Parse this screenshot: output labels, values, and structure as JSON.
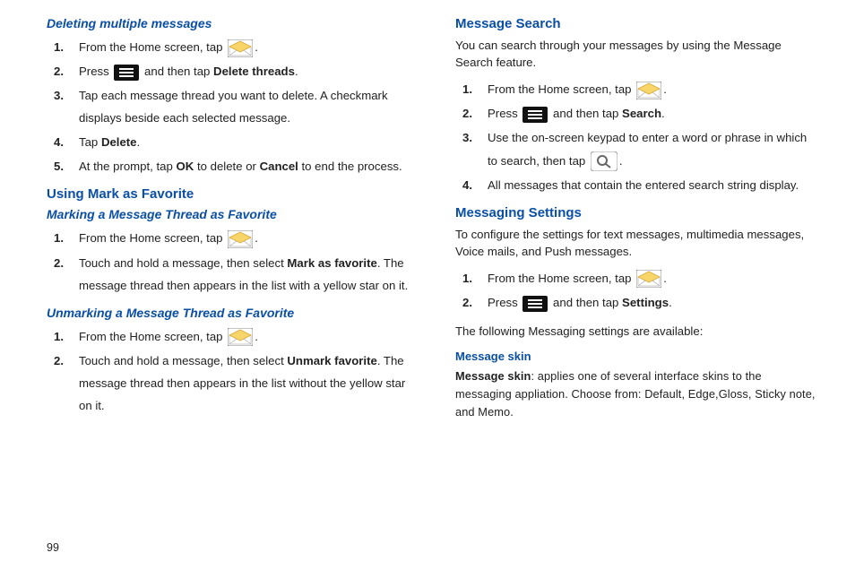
{
  "pageNumber": "99",
  "left": {
    "sec1": {
      "heading": "Deleting multiple messages",
      "steps": [
        {
          "num": "1.",
          "pre": "From the Home screen, tap ",
          "icon": "envelope",
          "post": "."
        },
        {
          "num": "2.",
          "pre": "Press ",
          "icon": "menu",
          "mid": " and then tap ",
          "bold": "Delete threads",
          "post": "."
        },
        {
          "num": "3.",
          "text": "Tap each message thread you want to delete. A checkmark displays beside each selected message."
        },
        {
          "num": "4.",
          "pre": "Tap ",
          "bold": "Delete",
          "post": "."
        },
        {
          "num": "5.",
          "pre": "At the prompt, tap ",
          "bold": "OK",
          "mid": " to delete or ",
          "bold2": "Cancel",
          "post": " to end the process."
        }
      ]
    },
    "sec2": {
      "heading": "Using Mark as Favorite",
      "sub1": {
        "heading": "Marking a Message Thread as Favorite",
        "steps": [
          {
            "num": "1.",
            "pre": "From the Home screen, tap ",
            "icon": "envelope",
            "post": "."
          },
          {
            "num": "2.",
            "pre": "Touch and hold a message, then select ",
            "bold": "Mark as favorite",
            "post": ". The message thread then appears in the list with a yellow star on it."
          }
        ]
      },
      "sub2": {
        "heading": "Unmarking a Message Thread as Favorite",
        "steps": [
          {
            "num": "1.",
            "pre": "From the Home screen, tap ",
            "icon": "envelope",
            "post": "."
          },
          {
            "num": "2.",
            "pre": "Touch and hold a message, then select ",
            "bold": "Unmark favorite",
            "post": ". The message thread then appears in the list without the yellow star on it."
          }
        ]
      }
    }
  },
  "right": {
    "sec1": {
      "heading": "Message Search",
      "intro": "You can search through your messages by using the Message Search feature.",
      "steps": [
        {
          "num": "1.",
          "pre": "From the Home screen, tap ",
          "icon": "envelope",
          "post": "."
        },
        {
          "num": "2.",
          "pre": "Press ",
          "icon": "menu",
          "mid": " and then tap ",
          "bold": "Search",
          "post": "."
        },
        {
          "num": "3.",
          "pre": "Use the on-screen keypad to enter a word or phrase in which to search, then tap ",
          "icon": "search",
          "post": "."
        },
        {
          "num": "4.",
          "text": "All messages that contain the entered search string display."
        }
      ]
    },
    "sec2": {
      "heading": "Messaging Settings",
      "intro": "To configure the settings for text messages, multimedia messages, Voice mails, and Push messages.",
      "steps": [
        {
          "num": "1.",
          "pre": "From the Home screen, tap ",
          "icon": "envelope",
          "post": "."
        },
        {
          "num": "2.",
          "pre": "Press ",
          "icon": "menu",
          "mid": " and then tap ",
          "bold": "Settings",
          "post": "."
        }
      ],
      "follow": "The following Messaging settings are available:",
      "sub": {
        "heading": "Message skin",
        "boldLead": "Message skin",
        "text": ": applies one of several interface skins to the messaging appliation. Choose from: Default, Edge,Gloss, Sticky note, and Memo."
      }
    }
  }
}
